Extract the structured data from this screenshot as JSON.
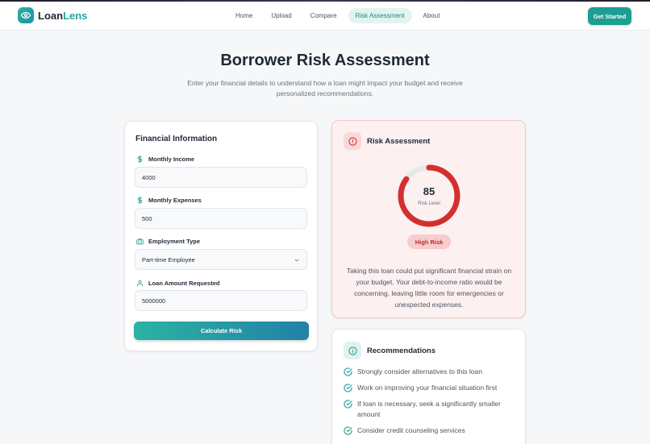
{
  "brand": {
    "name_part1": "Loan",
    "name_part2": "Lens"
  },
  "nav": {
    "items": [
      {
        "label": "Home",
        "active": false
      },
      {
        "label": "Upload",
        "active": false
      },
      {
        "label": "Compare",
        "active": false
      },
      {
        "label": "Risk Assessment",
        "active": true
      },
      {
        "label": "About",
        "active": false
      }
    ],
    "cta_label": "Get Started"
  },
  "page": {
    "title": "Borrower Risk Assessment",
    "subtitle": "Enter your financial details to understand how a loan might impact your budget and receive personalized recommendations."
  },
  "form": {
    "title": "Financial Information",
    "monthly_income": {
      "label": "Monthly Income",
      "value": "4000",
      "icon": "dollar-icon"
    },
    "monthly_expenses": {
      "label": "Monthly Expenses",
      "value": "500",
      "icon": "dollar-icon"
    },
    "employment_type": {
      "label": "Employment Type",
      "value": "Part-time Employee",
      "icon": "briefcase-icon"
    },
    "loan_amount": {
      "label": "Loan Amount Requested",
      "value": "5000000",
      "icon": "user-icon"
    },
    "submit_label": "Calculate Risk"
  },
  "risk": {
    "title": "Risk Assessment",
    "score": "85",
    "score_fraction": 0.85,
    "score_label": "Risk Level",
    "level": "High Risk",
    "description": "Taking this loan could put significant financial strain on your budget. Your debt-to-income ratio would be concerning, leaving little room for emergencies or unexpected expenses.",
    "icon": "alert-circle-icon"
  },
  "recommendations": {
    "title": "Recommendations",
    "icon": "info-icon",
    "items": [
      "Strongly consider alternatives to this loan",
      "Work on improving your financial situation first",
      "If loan is necessary, seek a significantly smaller amount",
      "Consider credit counseling services"
    ]
  },
  "colors": {
    "accent": "#1d9e93",
    "danger": "#d32f2f",
    "danger_bg": "#fdf0f0",
    "nav_active_bg": "#e3f3f0"
  }
}
